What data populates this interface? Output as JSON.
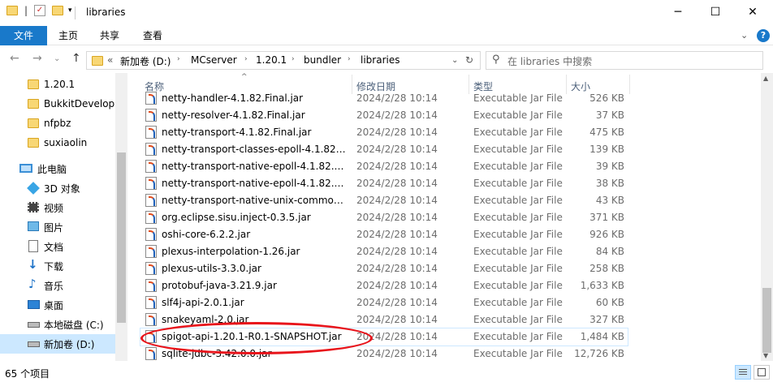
{
  "window": {
    "title": "libraries",
    "minimize_label": "─",
    "maximize_label": "☐",
    "close_label": "✕"
  },
  "ribbon": {
    "tabs": [
      "文件",
      "主页",
      "共享",
      "查看"
    ],
    "help_label": "?"
  },
  "address": {
    "back_label": "←",
    "forward_label": "→",
    "up_label": "↑",
    "recent_label": "⌄",
    "overflow_label": "«",
    "crumbs": [
      "新加卷 (D:)",
      "MCserver",
      "1.20.1",
      "bundler",
      "libraries"
    ],
    "refresh_label": "↻",
    "dropdown_label": "⌄"
  },
  "search": {
    "placeholder": "在 libraries 中搜索"
  },
  "nav": {
    "items": [
      {
        "label": "1.20.1",
        "icon": "folder-icon"
      },
      {
        "label": "BukkitDevelop",
        "icon": "folder-icon"
      },
      {
        "label": "nfpbz",
        "icon": "folder-icon"
      },
      {
        "label": "suxiaolin",
        "icon": "folder-icon"
      },
      {
        "label": "此电脑",
        "icon": "computer-icon"
      },
      {
        "label": "3D 对象",
        "icon": "cube-3d-icon"
      },
      {
        "label": "视频",
        "icon": "video-icon"
      },
      {
        "label": "图片",
        "icon": "pictures-icon"
      },
      {
        "label": "文档",
        "icon": "documents-icon"
      },
      {
        "label": "下载",
        "icon": "download-icon"
      },
      {
        "label": "音乐",
        "icon": "music-icon"
      },
      {
        "label": "桌面",
        "icon": "desktop-icon"
      },
      {
        "label": "本地磁盘 (C:)",
        "icon": "drive-icon"
      },
      {
        "label": "新加卷 (D:)",
        "icon": "drive-icon"
      }
    ]
  },
  "columns": {
    "name": "名称",
    "date": "修改日期",
    "type": "类型",
    "size": "大小"
  },
  "files": [
    {
      "name": "netty-handler-4.1.82.Final.jar",
      "date": "2024/2/28 10:14",
      "type": "Executable Jar File",
      "size": "526 KB"
    },
    {
      "name": "netty-resolver-4.1.82.Final.jar",
      "date": "2024/2/28 10:14",
      "type": "Executable Jar File",
      "size": "37 KB"
    },
    {
      "name": "netty-transport-4.1.82.Final.jar",
      "date": "2024/2/28 10:14",
      "type": "Executable Jar File",
      "size": "475 KB"
    },
    {
      "name": "netty-transport-classes-epoll-4.1.82.F...",
      "date": "2024/2/28 10:14",
      "type": "Executable Jar File",
      "size": "139 KB"
    },
    {
      "name": "netty-transport-native-epoll-4.1.82.Fi...",
      "date": "2024/2/28 10:14",
      "type": "Executable Jar File",
      "size": "39 KB"
    },
    {
      "name": "netty-transport-native-epoll-4.1.82.Fi...",
      "date": "2024/2/28 10:14",
      "type": "Executable Jar File",
      "size": "38 KB"
    },
    {
      "name": "netty-transport-native-unix-common-...",
      "date": "2024/2/28 10:14",
      "type": "Executable Jar File",
      "size": "43 KB"
    },
    {
      "name": "org.eclipse.sisu.inject-0.3.5.jar",
      "date": "2024/2/28 10:14",
      "type": "Executable Jar File",
      "size": "371 KB"
    },
    {
      "name": "oshi-core-6.2.2.jar",
      "date": "2024/2/28 10:14",
      "type": "Executable Jar File",
      "size": "926 KB"
    },
    {
      "name": "plexus-interpolation-1.26.jar",
      "date": "2024/2/28 10:14",
      "type": "Executable Jar File",
      "size": "84 KB"
    },
    {
      "name": "plexus-utils-3.3.0.jar",
      "date": "2024/2/28 10:14",
      "type": "Executable Jar File",
      "size": "258 KB"
    },
    {
      "name": "protobuf-java-3.21.9.jar",
      "date": "2024/2/28 10:14",
      "type": "Executable Jar File",
      "size": "1,633 KB"
    },
    {
      "name": "slf4j-api-2.0.1.jar",
      "date": "2024/2/28 10:14",
      "type": "Executable Jar File",
      "size": "60 KB"
    },
    {
      "name": "snakeyaml-2.0.jar",
      "date": "2024/2/28 10:14",
      "type": "Executable Jar File",
      "size": "327 KB"
    },
    {
      "name": "spigot-api-1.20.1-R0.1-SNAPSHOT.jar",
      "date": "2024/2/28 10:14",
      "type": "Executable Jar File",
      "size": "1,484 KB"
    },
    {
      "name": "sqlite-jdbc-3.42.0.0.jar",
      "date": "2024/2/28 10:14",
      "type": "Executable Jar File",
      "size": "12,726 KB"
    }
  ],
  "status": {
    "count": "65 个项目"
  },
  "colors": {
    "accent": "#1979ca",
    "selection": "#cce8ff",
    "annotation": "#e8141b"
  }
}
